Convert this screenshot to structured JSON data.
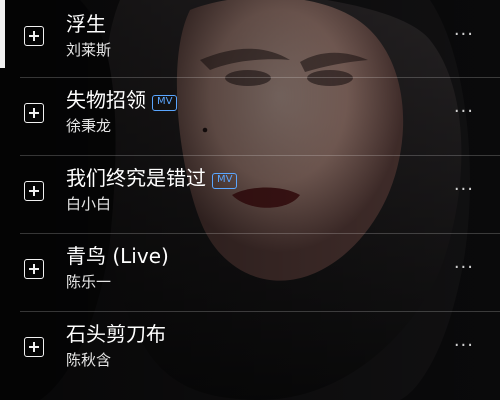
{
  "songs": [
    {
      "title": "浮生",
      "artist": "刘莱斯",
      "badge": ""
    },
    {
      "title": "失物招领",
      "artist": "徐秉龙",
      "badge": "MV"
    },
    {
      "title": "我们终究是错过",
      "artist": "白小白",
      "badge": "MV"
    },
    {
      "title": "青鸟 (Live)",
      "artist": "陈乐一",
      "badge": ""
    },
    {
      "title": "石头剪刀布",
      "artist": "陈秋含",
      "badge": ""
    }
  ],
  "icons": {
    "add": "add-to-playlist-icon",
    "more": "more-options-icon"
  },
  "more_glyph": "···",
  "colors": {
    "badge_blue": "#5aa6ff",
    "divider": "rgba(255,255,255,0.20)",
    "text_primary": "#ffffff",
    "text_secondary": "#e6e6e6"
  }
}
